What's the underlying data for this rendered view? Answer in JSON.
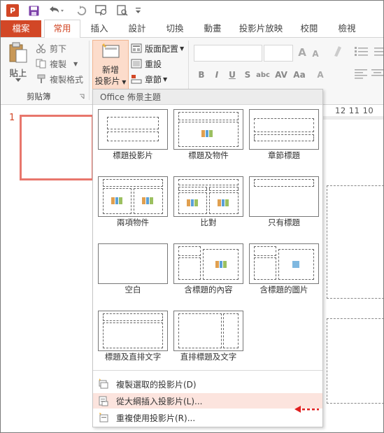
{
  "tabs": {
    "file": "檔案",
    "items": [
      "常用",
      "插入",
      "設計",
      "切換",
      "動畫",
      "投影片放映",
      "校閱",
      "檢視"
    ],
    "active": "常用"
  },
  "clipboard": {
    "paste": "貼上",
    "cut": "剪下",
    "copy": "複製",
    "format_painter": "複製格式",
    "group_label": "剪貼簿"
  },
  "slides": {
    "new_slide_line1": "新增",
    "new_slide_line2": "投影片",
    "layout": "版面配置",
    "reset": "重設",
    "section": "章節"
  },
  "font_buttons": {
    "bold": "B",
    "italic": "I",
    "underline": "U",
    "strike": "S"
  },
  "thumbnail": {
    "number": "1"
  },
  "ruler_text": "12 11 10",
  "dropdown": {
    "title": "Office 佈景主題",
    "layouts": [
      "標題投影片",
      "標題及物件",
      "章節標題",
      "兩項物件",
      "比對",
      "只有標題",
      "空白",
      "含標題的內容",
      "含標題的圖片",
      "標題及直排文字",
      "直排標題及文字"
    ],
    "menu": [
      "複製選取的投影片(D)",
      "從大綱插入投影片(L)...",
      "重複使用投影片(R)..."
    ],
    "highlighted_index": 1
  },
  "colors": {
    "accent": "#d24726",
    "highlight": "#fce4de",
    "thumb_border": "#e8766c",
    "arrow": "#e02020"
  }
}
